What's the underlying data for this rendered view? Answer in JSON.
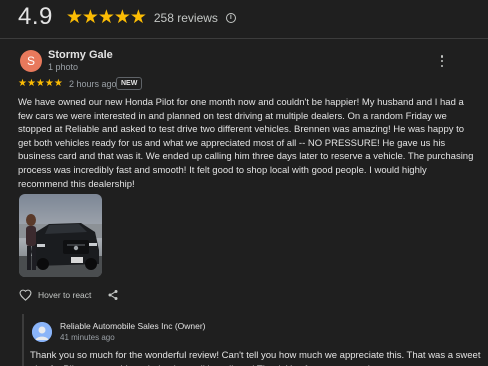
{
  "summary": {
    "rating": "4.9",
    "stars": "★★★★★",
    "review_count": "258 reviews",
    "info_icon_glyph": "i"
  },
  "review": {
    "avatar_letter": "S",
    "reviewer_name": "Stormy Gale",
    "reviewer_sub": "1 photo",
    "stars": "★★★★★",
    "time_ago": "2 hours ago",
    "badge": "NEW",
    "text": "We have owned our new Honda Pilot for one month now and couldn't be happier! My husband and I had a few cars we were interested in and planned on test driving at multiple dealers. On a random Friday we stopped at Reliable and asked to test drive two different vehicles. Brennen was amazing! He was happy to get both vehicles ready for us and what we appreciated most of all -- NO PRESSURE! He gave us his business card and that was it. We ended up calling him three days later to reserve a vehicle. The purchasing process was incredibly fast and smooth! It felt good to shop local with good people. I would highly recommend this dealership!",
    "hover_label": "Hover to react"
  },
  "owner_reply": {
    "name": "Reliable Automobile Sales Inc (Owner)",
    "time_ago": "41 minutes ago",
    "text": "Thank you so much for the wonderful review! Can't tell you how much we appreciate this. That was a sweet pic of a Pilot you got. Very glad to hear all is well, and Thank You from everyone here at"
  },
  "icons": {
    "info": "info-icon",
    "more": "more-vert-icon",
    "heart": "heart-icon",
    "share": "share-icon"
  },
  "colors": {
    "background": "#1f1f1f",
    "star": "#fbbc04",
    "avatar": "#e8795c",
    "text_primary": "#e3e3e3",
    "text_secondary": "#9aa0a6"
  }
}
